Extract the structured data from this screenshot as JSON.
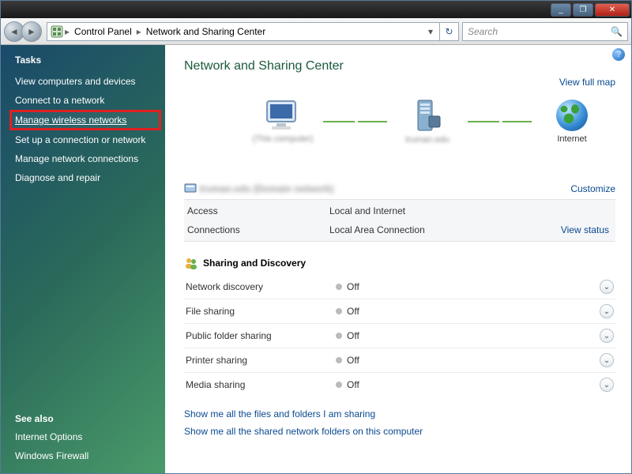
{
  "titlebar": {
    "min": "_",
    "max": "❐",
    "close": "✕"
  },
  "nav": {
    "back_glyph": "◄",
    "fwd_glyph": "►",
    "refresh_glyph": "↻",
    "dropdown_glyph": "▾"
  },
  "breadcrumb": {
    "root": "Control Panel",
    "sep": "▸",
    "current": "Network and Sharing Center"
  },
  "search": {
    "placeholder": "Search",
    "glyph": "🔍"
  },
  "sidebar": {
    "tasks_heading": "Tasks",
    "items": [
      "View computers and devices",
      "Connect to a network",
      "Manage wireless networks",
      "Set up a connection or network",
      "Manage network connections",
      "Diagnose and repair"
    ],
    "seealso_heading": "See also",
    "seealso_items": [
      "Internet Options",
      "Windows Firewall"
    ]
  },
  "content": {
    "help_glyph": "?",
    "title": "Network and Sharing Center",
    "view_full_map": "View full map",
    "map": {
      "computer_label": "(This computer)",
      "network_label": "truman.edu",
      "internet_label": "Internet"
    },
    "network_name_blur": "truman.edu (Domain network)",
    "customize": "Customize",
    "info": {
      "access_k": "Access",
      "access_v": "Local and Internet",
      "conn_k": "Connections",
      "conn_v": "Local Area Connection",
      "view_status": "View status"
    },
    "sharing_heading": "Sharing and Discovery",
    "sharing_rows": [
      {
        "k": "Network discovery",
        "v": "Off"
      },
      {
        "k": "File sharing",
        "v": "Off"
      },
      {
        "k": "Public folder sharing",
        "v": "Off"
      },
      {
        "k": "Printer sharing",
        "v": "Off"
      },
      {
        "k": "Media sharing",
        "v": "Off"
      }
    ],
    "chevron_glyph": "⌄",
    "bottom_links": [
      "Show me all the files and folders I am sharing",
      "Show me all the shared network folders on this computer"
    ]
  }
}
